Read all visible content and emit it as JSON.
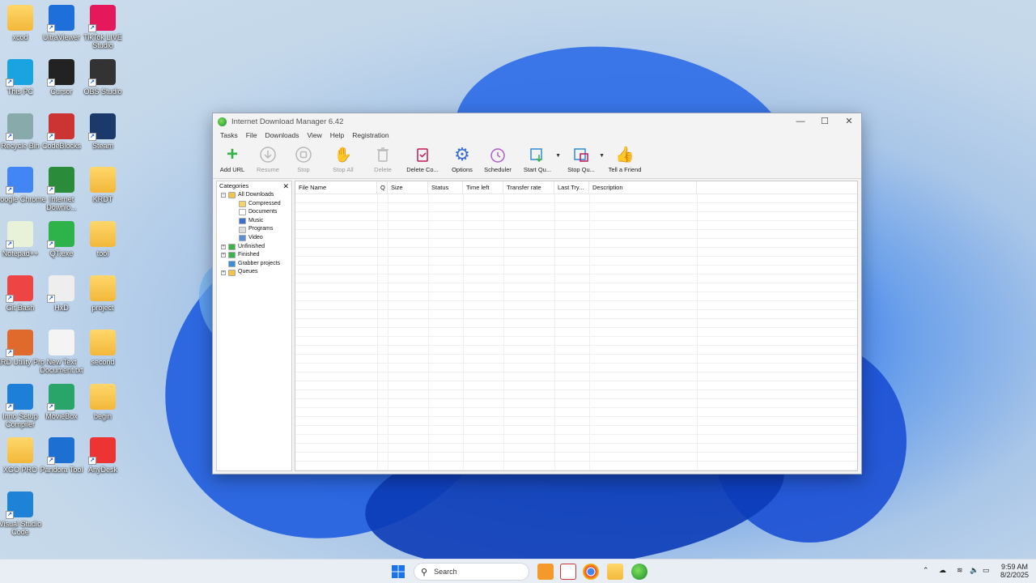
{
  "desktop": {
    "icons": [
      {
        "label": "xcod",
        "kind": "folder"
      },
      {
        "label": "UltraViewer",
        "kind": "app"
      },
      {
        "label": "TikTok LIVE Studio",
        "kind": "app"
      },
      {
        "label": "This PC",
        "kind": "app"
      },
      {
        "label": "Cursor",
        "kind": "app"
      },
      {
        "label": "OBS Studio",
        "kind": "app"
      },
      {
        "label": "Recycle Bin",
        "kind": "app"
      },
      {
        "label": "CodeBlocks",
        "kind": "app"
      },
      {
        "label": "Steam",
        "kind": "app"
      },
      {
        "label": "Google Chrome",
        "kind": "app"
      },
      {
        "label": "Internet Downlo...",
        "kind": "app"
      },
      {
        "label": "KRDT",
        "kind": "folder"
      },
      {
        "label": "Notepad++",
        "kind": "app"
      },
      {
        "label": "QT.exe",
        "kind": "app"
      },
      {
        "label": "tool",
        "kind": "folder"
      },
      {
        "label": "Git Bash",
        "kind": "app"
      },
      {
        "label": "HxD",
        "kind": "app"
      },
      {
        "label": "project",
        "kind": "folder"
      },
      {
        "label": "KRD Utility Pro",
        "kind": "app"
      },
      {
        "label": "New Text Document.txt",
        "kind": "file"
      },
      {
        "label": "second",
        "kind": "folder"
      },
      {
        "label": "Inno Setup Compiler",
        "kind": "app"
      },
      {
        "label": "MovieBox",
        "kind": "app"
      },
      {
        "label": "begin",
        "kind": "folder"
      },
      {
        "label": "XGO PRO",
        "kind": "folder"
      },
      {
        "label": "Pandora Tool",
        "kind": "app"
      },
      {
        "label": "AnyDesk",
        "kind": "app"
      },
      {
        "label": "Visual Studio Code",
        "kind": "app"
      }
    ]
  },
  "window": {
    "title": "Internet Download Manager 6.42",
    "controls": {
      "minimize": "—",
      "maximize": "☐",
      "close": "✕"
    },
    "menu": [
      "Tasks",
      "File",
      "Downloads",
      "View",
      "Help",
      "Registration"
    ],
    "toolbar": [
      {
        "label": "Add URL",
        "icon": "add-icon",
        "enabled": true
      },
      {
        "label": "Resume",
        "icon": "resume-icon",
        "enabled": false
      },
      {
        "label": "Stop",
        "icon": "stop-icon",
        "enabled": false
      },
      {
        "label": "Stop All",
        "icon": "hand-icon",
        "enabled": false
      },
      {
        "label": "Delete",
        "icon": "trash-icon",
        "enabled": false
      },
      {
        "label": "Delete Co...",
        "icon": "delete-completed-icon",
        "enabled": true
      },
      {
        "label": "Options",
        "icon": "gear-icon",
        "enabled": true
      },
      {
        "label": "Scheduler",
        "icon": "clock-icon",
        "enabled": true
      },
      {
        "label": "Start Qu...",
        "icon": "start-queue-icon",
        "enabled": true
      },
      {
        "label": "Stop Qu...",
        "icon": "stop-queue-icon",
        "enabled": true
      },
      {
        "label": "Tell a Friend",
        "icon": "thumbs-up-icon",
        "enabled": true
      }
    ],
    "categories": {
      "header": "Categories",
      "close": "✕",
      "tree": [
        {
          "label": "All Downloads",
          "level": 0,
          "expander": "−"
        },
        {
          "label": "Compressed",
          "level": 1
        },
        {
          "label": "Documents",
          "level": 1
        },
        {
          "label": "Music",
          "level": 1
        },
        {
          "label": "Programs",
          "level": 1
        },
        {
          "label": "Video",
          "level": 1
        },
        {
          "label": "Unfinished",
          "level": 0,
          "expander": "+"
        },
        {
          "label": "Finished",
          "level": 0,
          "expander": "+"
        },
        {
          "label": "Grabber projects",
          "level": 0
        },
        {
          "label": "Queues",
          "level": 0,
          "expander": "+"
        }
      ]
    },
    "columns": [
      "File Name",
      "Q",
      "Size",
      "Status",
      "Time left",
      "Transfer rate",
      "Last Try...",
      "Description"
    ]
  },
  "taskbar": {
    "search_placeholder": "Search",
    "time": "9:59 AM",
    "date": "8/2/2025"
  },
  "colors": {
    "accent": "#1a5fd0",
    "folder": "#f3b83a"
  }
}
